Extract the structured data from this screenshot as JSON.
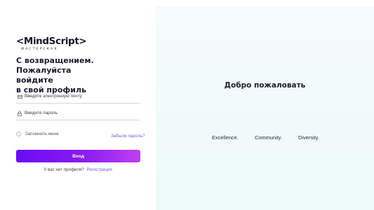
{
  "logo": {
    "main": "<MindScript>",
    "sub": "МАСТЕРСКАЯ"
  },
  "login": {
    "heading_line1": "С возвращением. Пожалуйста",
    "heading_line2": "войдите",
    "heading_line3": "в свой профиль",
    "email_placeholder": "Введите электронную почту",
    "password_placeholder": "Введите пароль",
    "remember_label": "Запомнить меня",
    "remember_checked": false,
    "forgot_link": "Забыли пароль?",
    "submit_label": "Вход",
    "no_profile_text": "У вас нет профиля?",
    "signup_link": "Регистрация"
  },
  "welcome": {
    "title": "Добро пожаловать",
    "values": [
      "Excellence.",
      "Community.",
      "Diversity."
    ]
  },
  "colors": {
    "accent": "#6d5fe0",
    "button_gradient_start": "#6a0bf5",
    "button_gradient_end": "#c13ff2",
    "panel_bg": "#f2fafa"
  },
  "icons": {
    "email": "mail-icon",
    "password": "lock-icon"
  }
}
